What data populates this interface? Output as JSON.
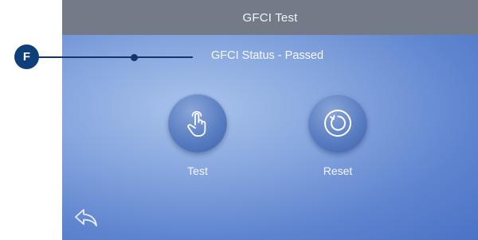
{
  "header": {
    "title": "GFCI Test"
  },
  "status": {
    "text": "GFCI Status - Passed"
  },
  "callout": {
    "letter": "F"
  },
  "buttons": {
    "test_label": "Test",
    "reset_label": "Reset"
  },
  "icons": {
    "test": "hand-pointer-icon",
    "reset": "reset-icon",
    "back": "back-arrow-icon"
  },
  "colors": {
    "title_bar": "#747b88",
    "background": "#6f91d6",
    "callout": "#0f3f78"
  }
}
